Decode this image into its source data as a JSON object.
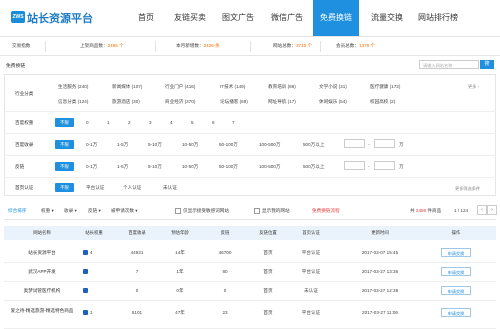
{
  "brand": {
    "logo_mark": "ZWS",
    "name": "站长资源平台"
  },
  "nav": [
    {
      "label": "首页"
    },
    {
      "label": "友链买卖"
    },
    {
      "label": "图文广告"
    },
    {
      "label": "微信广告"
    },
    {
      "label": "免费换链"
    },
    {
      "label": "流量交换"
    },
    {
      "label": "网站排行榜"
    }
  ],
  "stats": {
    "trade_label": "交易指数",
    "links_label": "上架商品数：",
    "links_value": "2465 个",
    "new_label": "本月新增数：",
    "new_value": "2426 条",
    "sites_label": "网站总数：",
    "sites_value": "3710 个",
    "members_label": "会员总数：",
    "members_value": "1376 个"
  },
  "filter": {
    "title": "免费换链",
    "search_placeholder": "请输入网站名称",
    "search_btn": "搜",
    "more_label": "更多 ›",
    "more_filters": "更多筛选条件",
    "rows": [
      {
        "label": "行业分类"
      },
      {
        "label": "百度权重"
      },
      {
        "label": "百度收录"
      },
      {
        "label": "反链"
      },
      {
        "label": "首页认证"
      }
    ],
    "categories_line1": [
      "生活服务 (240)",
      "新闻媒体 (107)",
      "行业门户 (416)",
      "IT技术 (149)",
      "教育培训 (86)",
      "文学小说 (31)",
      "医疗健康 (172)"
    ],
    "categories_line2": [
      "信息分类 (124)",
      "旅游酒店 (30)",
      "商业经济 (370)",
      "论坛播客 (69)",
      "网址导航 (17)",
      "休闲娱乐 (54)",
      "校园高校 (2)"
    ],
    "unlimited": "不限",
    "weights": [
      "0",
      "1",
      "2",
      "3",
      "4",
      "5",
      "6",
      "7"
    ],
    "index_opts": [
      "0-1万",
      "1-5万",
      "5-10万",
      "10-50万",
      "50-100万",
      "100-500万",
      "500万以上"
    ],
    "backlink_opts": [
      "0-1万",
      "1-5万",
      "5-10万",
      "10-50万",
      "50-100万",
      "100-500万",
      "500万以上"
    ],
    "range_unit": "万",
    "range_dash": "-",
    "cert_opts": [
      "平台认证",
      "个人认证",
      "未认证"
    ]
  },
  "sortbar": {
    "items": [
      "综合排序",
      "权重 ▾",
      "收录 ▾",
      "反链 ▾",
      "被申请次数 ▾"
    ],
    "check1": "仅显示接受敏感词网站",
    "check2": "显示我的网站",
    "red_note": "免费换链流程",
    "result_prefix": "共",
    "result_count": "2455",
    "result_suffix": "件商品",
    "page": "1 / 124",
    "prev": "‹",
    "next": "›"
  },
  "table": {
    "headers": [
      "网站名称",
      "站长权重",
      "百度收录",
      "预估年龄",
      "反链",
      "友链位置",
      "首页认证",
      "更新时间",
      "操作"
    ],
    "rows": [
      {
        "name": "站长资源平台",
        "weight": "4",
        "index": "44931",
        "age": "14年",
        "backlinks": "46700",
        "position": "首页",
        "cert": "平台认证",
        "updated": "2017-03-07 15:45",
        "action": "申请交换"
      },
      {
        "name": "武汉APP开发",
        "weight": "",
        "index": "7",
        "age": "1年",
        "backlinks": "80",
        "position": "首页",
        "cert": "平台认证",
        "updated": "2017-03-27 13:36",
        "action": "申请交换"
      },
      {
        "name": "奥梦试管医疗机构",
        "weight": "",
        "index": "0",
        "age": "0年",
        "backlinks": "0",
        "position": "首页",
        "cert": "未认证",
        "updated": "2017-03-27 12:38",
        "action": "申请交换"
      },
      {
        "name": "爱之待-精选旅游-精选特色商品",
        "weight": "1",
        "index": "5101",
        "age": "47年",
        "backlinks": "23",
        "position": "首页",
        "cert": "平台认证",
        "updated": "2017-03-27 11:06",
        "action": "申请交换"
      }
    ]
  },
  "colors": {
    "accent": "#1f8fdf",
    "highlight": "#ff6a00",
    "warn": "#e4393c"
  }
}
